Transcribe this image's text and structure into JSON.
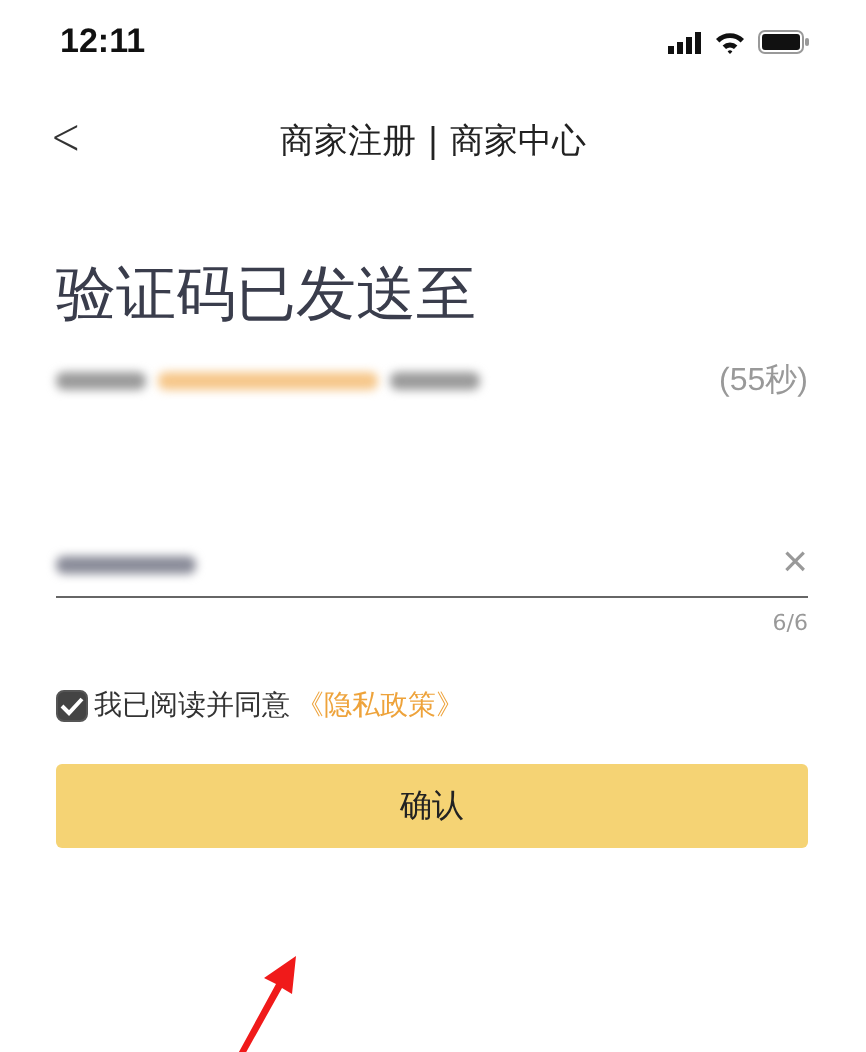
{
  "status_bar": {
    "time": "12:11"
  },
  "nav": {
    "back": "<",
    "title": "商家注册 | 商家中心"
  },
  "heading": "验证码已发送至",
  "sent_to": {
    "redacted": true,
    "countdown": "(55秒)"
  },
  "code_field": {
    "redacted": true,
    "clear": "×",
    "counter": "6/6"
  },
  "agreement": {
    "checked": true,
    "text": "我已阅读并同意",
    "link": "《隐私政策》"
  },
  "confirm_button": "确认",
  "annotation": {
    "arrow": true
  }
}
